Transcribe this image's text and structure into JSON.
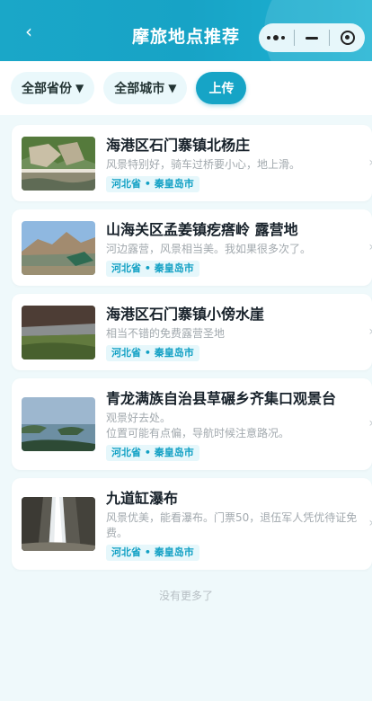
{
  "header": {
    "title": "摩旅地点推荐",
    "back_icon": "‹"
  },
  "filters": {
    "province_label": "全部省份",
    "city_label": "全部城市",
    "arrow": "▼",
    "upload_label": "上传"
  },
  "places": [
    {
      "name": "海港区石门寨镇北杨庄",
      "desc": "风景特别好，骑车过桥要小心，地上滑。",
      "location": "河北省 • 秦皇岛市"
    },
    {
      "name": "山海关区孟姜镇疙瘩岭 露营地",
      "desc": "河边露营，风景相当美。我如果很多次了。",
      "location": "河北省 • 秦皇岛市"
    },
    {
      "name": "海港区石门寨镇小傍水崖",
      "desc": "相当不错的免费露营圣地",
      "location": "河北省 • 秦皇岛市"
    },
    {
      "name": "青龙满族自治县草碾乡齐集口观景台",
      "desc": "观景好去处。\n位置可能有点偏，导航时候注意路况。",
      "location": "河北省 • 秦皇岛市"
    },
    {
      "name": "九道缸瀑布",
      "desc": "风景优美，能看瀑布。门票50，退伍军人凭优待证免费。",
      "location": "河北省 • 秦皇岛市"
    }
  ],
  "footer": {
    "no_more": "没有更多了"
  },
  "colors": {
    "accent": "#16a4c6",
    "tag_text": "#11a0c4",
    "tag_bg": "#e6f7fb"
  }
}
